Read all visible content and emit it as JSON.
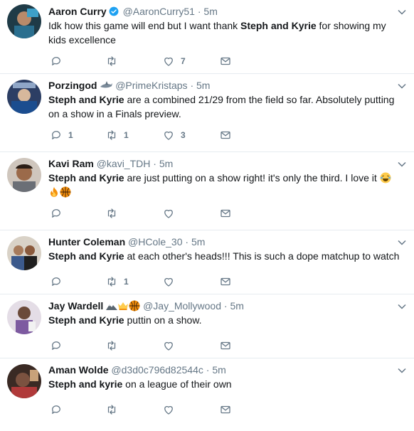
{
  "tweets": [
    {
      "name": "Aaron Curry",
      "handle": "@AaronCurry51",
      "dot": "·",
      "time": "5m",
      "text_pre": "Idk how this game will end but I want thank ",
      "text_bold": "Steph and Kyrie",
      "text_post": " for showing my kids excellence",
      "replies": "",
      "retweets": "",
      "likes": "7"
    },
    {
      "name": "Porzingod",
      "handle": "@PrimeKristaps",
      "dot": "·",
      "time": "5m",
      "text_pre": "",
      "text_bold": "Steph and Kyrie",
      "text_post": " are a combined 21/29 from the field so far. Absolutely putting on a show in a Finals preview.",
      "replies": "1",
      "retweets": "1",
      "likes": "3"
    },
    {
      "name": "Kavi Ram",
      "handle": "@kavi_TDH",
      "dot": "·",
      "time": "5m",
      "text_pre": "",
      "text_bold": "Steph and Kyrie",
      "text_post": " are just putting on a show right! it's only the third. I love it ",
      "replies": "",
      "retweets": "",
      "likes": ""
    },
    {
      "name": "Hunter Coleman",
      "handle": "@HCole_30",
      "dot": "·",
      "time": "5m",
      "text_pre": "",
      "text_bold": "Steph and Kyrie",
      "text_post": " at each other's heads!!! This is such a dope matchup to watch",
      "replies": "",
      "retweets": "1",
      "likes": ""
    },
    {
      "name": "Jay Wardell",
      "handle": "@Jay_Mollywood",
      "dot": "·",
      "time": "5m",
      "text_pre": "",
      "text_bold": "Steph and Kyrie",
      "text_post": " puttin on a show.",
      "replies": "",
      "retweets": "",
      "likes": ""
    },
    {
      "name": "Aman Wolde",
      "handle": "@d3d0c796d82544c",
      "dot": "·",
      "time": "5m",
      "text_pre": "",
      "text_bold": "Steph and kyrie",
      "text_post": " on a league of their own",
      "replies": "",
      "retweets": "",
      "likes": ""
    }
  ],
  "colors": {
    "name": "#14171a",
    "secondary": "#657786",
    "verified": "#1da1f2",
    "divider": "#e6ecf0"
  }
}
